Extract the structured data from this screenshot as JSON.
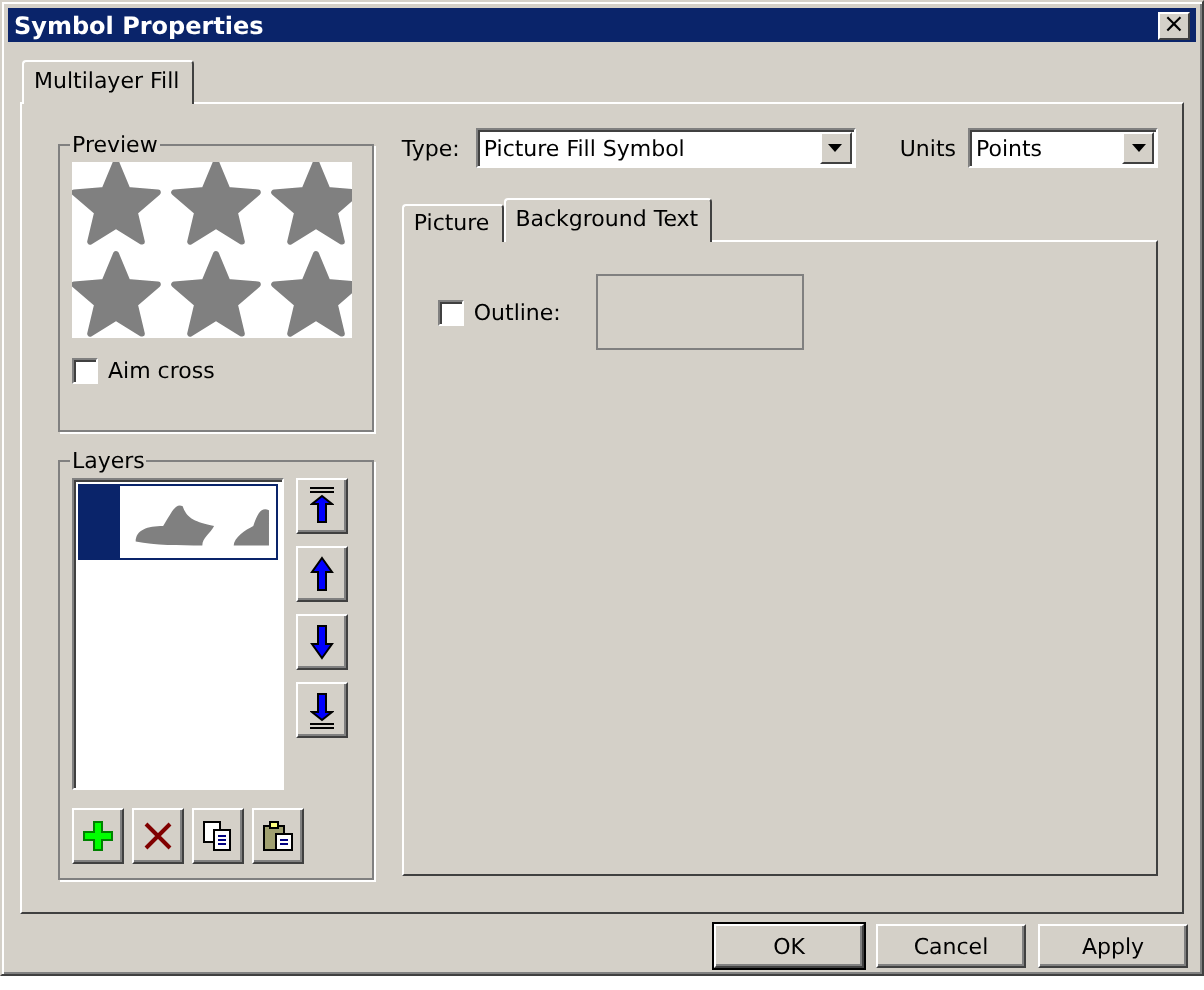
{
  "window": {
    "title": "Symbol Properties",
    "close": "×"
  },
  "outer_tabs": [
    {
      "label": "Multilayer Fill",
      "selected": true
    }
  ],
  "preview": {
    "title": "Preview",
    "aim_cross": {
      "label": "Aim cross",
      "checked": false
    }
  },
  "layers": {
    "title": "Layers",
    "items": [
      {
        "selected": true
      }
    ]
  },
  "type": {
    "label": "Type:",
    "value": "Picture Fill Symbol"
  },
  "units": {
    "label": "Units",
    "value": "Points"
  },
  "inner_tabs": [
    {
      "label": "Picture",
      "selected": false
    },
    {
      "label": "Background Text",
      "selected": true
    }
  ],
  "outline": {
    "label": "Outline:",
    "checked": false
  },
  "buttons": [
    "OK",
    "Cancel",
    "Apply"
  ]
}
